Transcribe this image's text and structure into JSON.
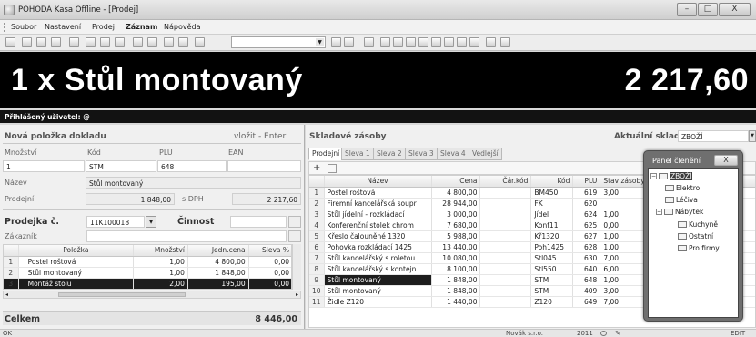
{
  "window": {
    "title": "POHODA Kasa Offline - [Prodej]",
    "minimize": "–",
    "maximize": "□",
    "close": "X"
  },
  "menu": [
    "Soubor",
    "Nastavení",
    "Prodej",
    "Záznam",
    "Nápověda"
  ],
  "banner": {
    "item_text": "1 x Stůl montovaný",
    "amount": "2 217,60"
  },
  "user_bar": {
    "label": "Přihlášený uživatel: @"
  },
  "new_item": {
    "title": "Nová položka dokladu",
    "insert_label": "vložit - Enter",
    "qty_label": "Množství",
    "code_label": "Kód",
    "plu_label": "PLU",
    "ean_label": "EAN",
    "qty_value": "1",
    "code_value": "STM",
    "plu_value": "648",
    "ean_value": "",
    "name_label": "Název",
    "name_value": "Stůl montovaný",
    "price_label": "Prodejní",
    "price_value": "1 848,00",
    "vat_label": "s DPH",
    "vat_value": "2 217,60"
  },
  "receipt": {
    "title": "Prodejka č.",
    "number": "11K100018",
    "activity_label": "Činnost",
    "activity_value": "",
    "customer_label": "Zákazník",
    "customer_value": "",
    "columns": [
      "",
      "Položka",
      "Množství",
      "Jedn.cena",
      "Sleva %"
    ],
    "rows": [
      {
        "n": "1",
        "item": "Postel roštová",
        "qty": "1,00",
        "price": "4 800,00",
        "disc": "0,00"
      },
      {
        "n": "2",
        "item": "Stůl montovaný",
        "qty": "1,00",
        "price": "1 848,00",
        "disc": "0,00"
      },
      {
        "n": "3",
        "item": "Montáž stolu",
        "qty": "2,00",
        "price": "195,00",
        "disc": "0,00"
      }
    ],
    "total_label": "Celkem",
    "total_value": "8 446,00"
  },
  "stock": {
    "title": "Skladové zásoby",
    "current_label": "Aktuální sklad",
    "current_value": "ZBOŽÍ",
    "tabs": [
      "Prodejní",
      "Sleva 1",
      "Sleva 2",
      "Sleva 3",
      "Sleva 4",
      "Vedlejší"
    ],
    "columns": [
      "",
      "Název",
      "Cena",
      "Čár.kód",
      "Kód",
      "PLU",
      "Stav zásoby"
    ],
    "rows": [
      {
        "n": "1",
        "name": "Postel roštová",
        "price": "4 800,00",
        "barcode": "",
        "code": "BM450",
        "plu": "619",
        "stock": "3,00"
      },
      {
        "n": "2",
        "name": "Firemní kancelářská soupr",
        "price": "28 944,00",
        "barcode": "",
        "code": "FK",
        "plu": "620",
        "stock": ""
      },
      {
        "n": "3",
        "name": "Stůl jídelní - rozkládací",
        "price": "3 000,00",
        "barcode": "",
        "code": "Jídel",
        "plu": "624",
        "stock": "1,00"
      },
      {
        "n": "4",
        "name": "Konferenční stolek chrom",
        "price": "7 680,00",
        "barcode": "",
        "code": "Konf11",
        "plu": "625",
        "stock": "0,00"
      },
      {
        "n": "5",
        "name": "Křeslo čalouněné 1320",
        "price": "5 988,00",
        "barcode": "",
        "code": "Kř1320",
        "plu": "627",
        "stock": "1,00"
      },
      {
        "n": "6",
        "name": "Pohovka rozkládací 1425",
        "price": "13 440,00",
        "barcode": "",
        "code": "Poh1425",
        "plu": "628",
        "stock": "1,00"
      },
      {
        "n": "7",
        "name": "Stůl kancelářský s roletou",
        "price": "10 080,00",
        "barcode": "",
        "code": "Stl045",
        "plu": "630",
        "stock": "7,00"
      },
      {
        "n": "8",
        "name": "Stůl kancelářský s kontejn",
        "price": "8 100,00",
        "barcode": "",
        "code": "Stl550",
        "plu": "640",
        "stock": "6,00"
      },
      {
        "n": "9",
        "name": "Stůl montovaný",
        "price": "1 848,00",
        "barcode": "",
        "code": "STM",
        "plu": "648",
        "stock": "1,00"
      },
      {
        "n": "10",
        "name": "Stůl montovaný",
        "price": "1 848,00",
        "barcode": "",
        "code": "STM",
        "plu": "409",
        "stock": "3,00"
      },
      {
        "n": "11",
        "name": "Židle Z120",
        "price": "1 440,00",
        "barcode": "",
        "code": "Z120",
        "plu": "649",
        "stock": "7,00"
      }
    ]
  },
  "panel": {
    "title": "Panel členění",
    "close": "X",
    "tree": [
      {
        "label": "ZBOŽÍ",
        "level": 0,
        "exp": "−"
      },
      {
        "label": "Elektro",
        "level": 1
      },
      {
        "label": "Léčiva",
        "level": 1
      },
      {
        "label": "Nábytek",
        "level": 1,
        "exp": "−"
      },
      {
        "label": "Kuchyně",
        "level": 2
      },
      {
        "label": "Ostatní",
        "level": 2
      },
      {
        "label": "Pro firmy",
        "level": 2
      }
    ]
  },
  "status": {
    "left": "OK",
    "company": "Novák s.r.o.",
    "year": "2011",
    "mode": "EDIT"
  }
}
